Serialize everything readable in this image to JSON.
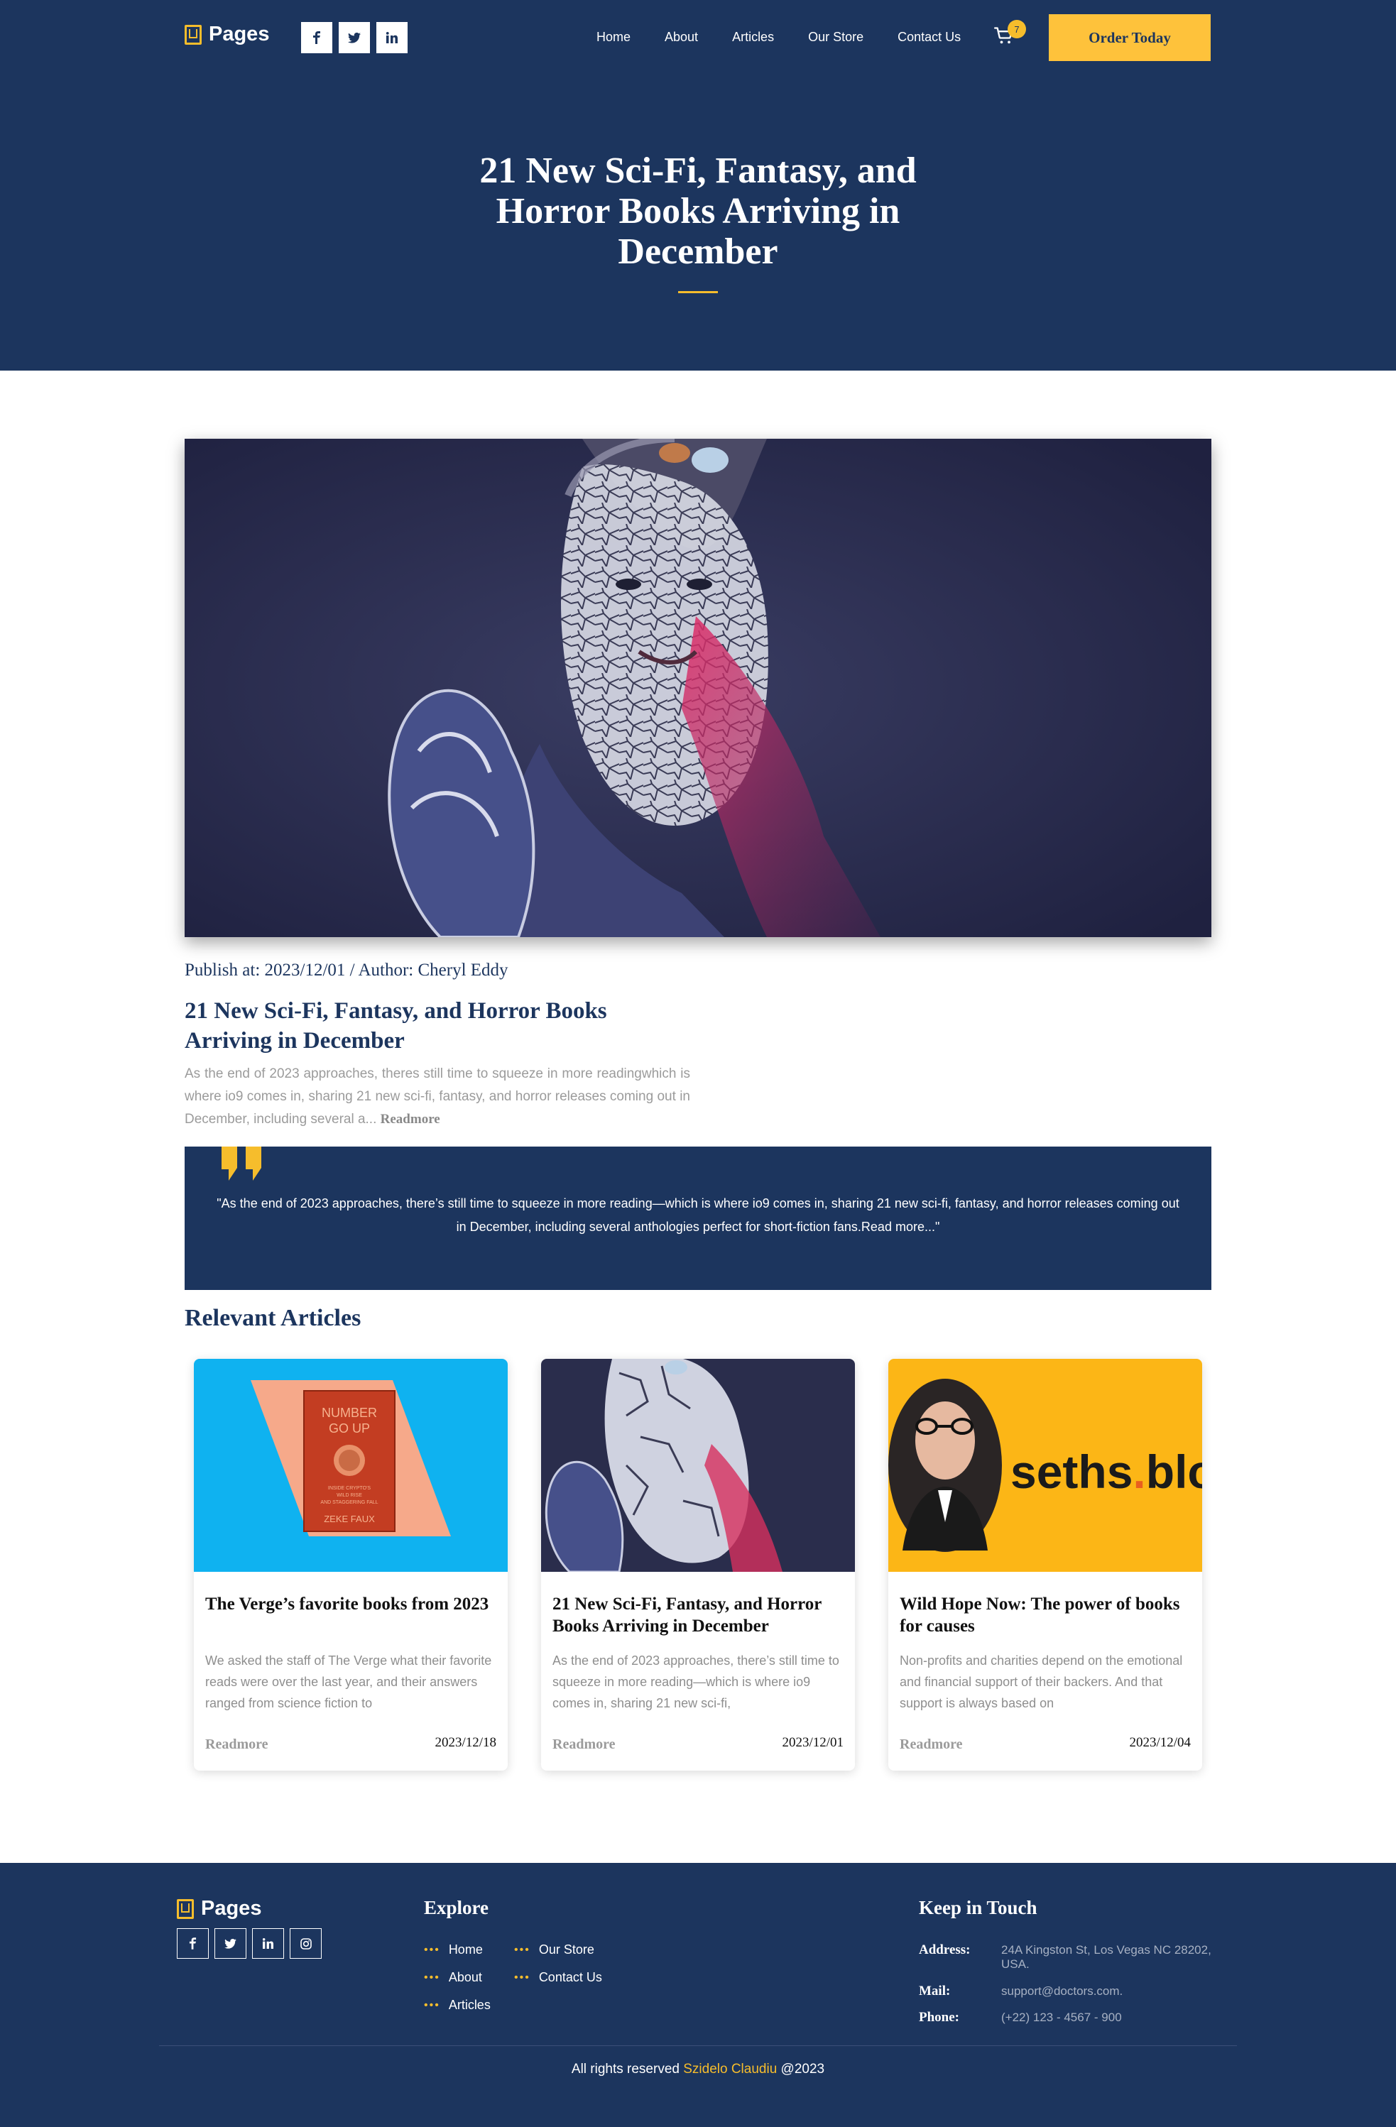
{
  "header": {
    "logo": "Pages",
    "socials": [
      "f",
      "t",
      "in"
    ],
    "nav": [
      "Home",
      "About",
      "Articles",
      "Our Store",
      "Contact Us"
    ],
    "cart_count": "7",
    "order_button": "Order Today"
  },
  "hero": {
    "title": "21 New Sci-Fi, Fantasy, and Horror Books Arriving in December"
  },
  "article": {
    "meta": "Publish at: 2023/12/01 / Author: Cheryl Eddy",
    "title": "21 New Sci-Fi, Fantasy, and Horror Books Arriving in December",
    "excerpt": "As the end of 2023 approaches, theres still time to squeeze in more readingwhich is where io9 comes in, sharing 21 new sci-fi, fantasy, and horror releases coming out in December, including several a...",
    "readmore": "Readmore"
  },
  "quote": {
    "text": "\"As the end of 2023 approaches, there’s still time to squeeze in more reading—which is where io9 comes in, sharing 21 new sci-fi, fantasy, and horror releases coming out in December, including several anthologies perfect for short-fiction fans.Read more...\""
  },
  "relevant": {
    "heading": "Relevant Articles",
    "cards": [
      {
        "title": "The Verge’s favorite books from 2023",
        "text": "We asked the staff of The Verge what their favorite reads were over the last year, and their answers ranged from science fiction to",
        "readmore": "Readmore",
        "date": "2023/12/18",
        "book": {
          "line1": "NUMBER",
          "line2": "GO UP",
          "sub1": "INSIDE CRYPTO'S",
          "sub2": "WILD RISE",
          "sub3": "AND STAGGERING FALL",
          "author": "ZEKE FAUX"
        }
      },
      {
        "title": "21 New Sci-Fi, Fantasy, and Horror Books Arriving in December",
        "text": "As the end of 2023 approaches, there’s still time to squeeze in more reading—which is where io9 comes in, sharing 21 new sci-fi,",
        "readmore": "Readmore",
        "date": "2023/12/01"
      },
      {
        "title": "Wild Hope Now: The power of books for causes",
        "text": "Non-profits and charities depend on the emotional and financial support of their backers. And that support is always based on",
        "readmore": "Readmore",
        "date": "2023/12/04",
        "brand": {
          "a": "seths",
          "dot": ".",
          "b": "blo"
        }
      }
    ]
  },
  "footer": {
    "logo": "Pages",
    "socials": [
      "f",
      "t",
      "in",
      "ig"
    ],
    "explore_heading": "Explore",
    "explore_col1": [
      "Home",
      "About",
      "Articles"
    ],
    "explore_col2": [
      "Our Store",
      "Contact Us"
    ],
    "keep_heading": "Keep in Touch",
    "address_label": "Address:",
    "address_line1": "24A Kingston St, Los Vegas NC 28202,",
    "address_line2": "USA.",
    "mail_label": "Mail:",
    "mail_value": "support@doctors.com.",
    "phone_label": "Phone:",
    "phone_value": "(+22) 123 - 4567 - 900",
    "copyright_pre": "All rights reserved",
    "copyright_name": "Szidelo Claudiu",
    "copyright_post": "@2023"
  },
  "colors": {
    "navy": "#1c355e",
    "accent": "#f6bd2c",
    "button": "#fec23b"
  }
}
